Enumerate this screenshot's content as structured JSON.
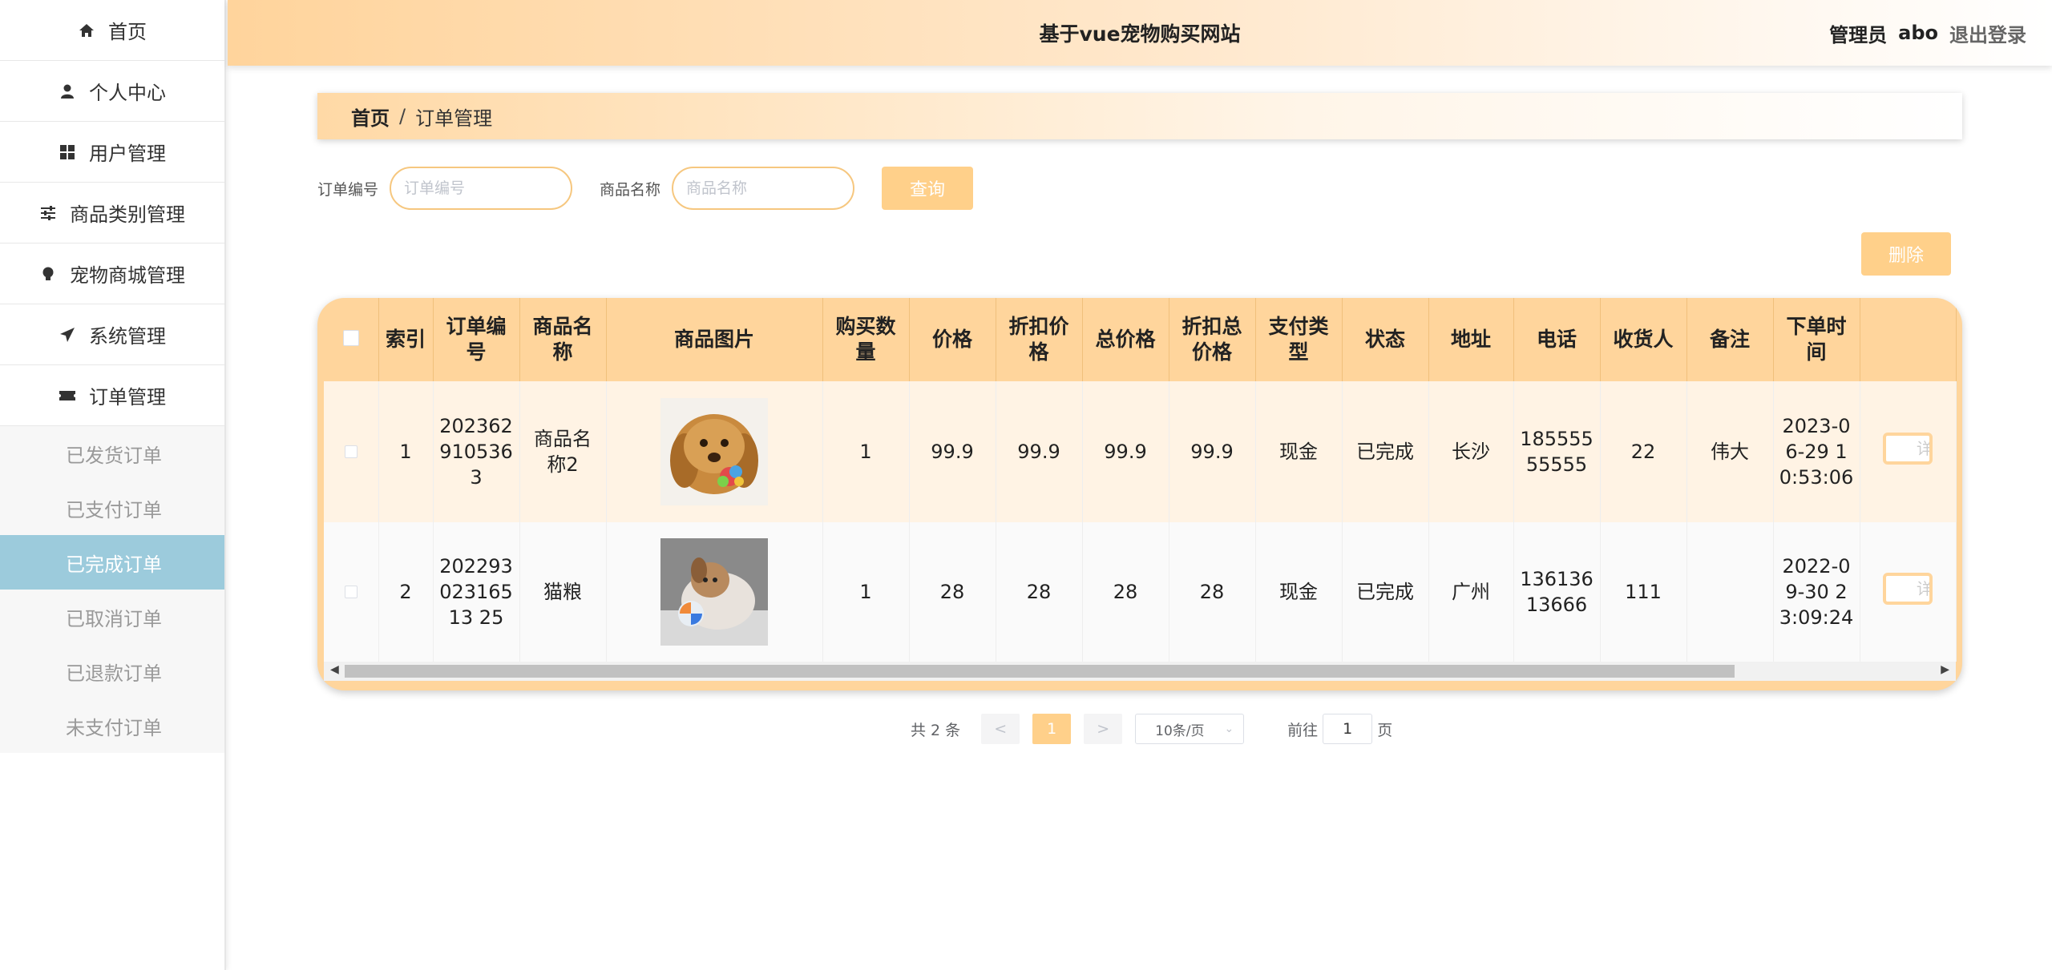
{
  "sidebar": {
    "items": [
      {
        "label": "首页",
        "icon": "home-icon"
      },
      {
        "label": "个人中心",
        "icon": "user-icon"
      },
      {
        "label": "用户管理",
        "icon": "grid-icon"
      },
      {
        "label": "商品类别管理",
        "icon": "sliders-icon"
      },
      {
        "label": "宠物商城管理",
        "icon": "bulb-icon"
      },
      {
        "label": "系统管理",
        "icon": "send-icon"
      },
      {
        "label": "订单管理",
        "icon": "ticket-icon"
      }
    ],
    "sub_items": [
      "已发货订单",
      "已支付订单",
      "已完成订单",
      "已取消订单",
      "已退款订单",
      "未支付订单"
    ],
    "active_sub": "已完成订单"
  },
  "header": {
    "title": "基于vue宠物购买网站",
    "role": "管理员",
    "username": "abo",
    "logout": "退出登录"
  },
  "breadcrumb": {
    "home": "首页",
    "sep": "/",
    "current": "订单管理"
  },
  "search": {
    "order_no_label": "订单编号",
    "order_no_placeholder": "订单编号",
    "goods_name_label": "商品名称",
    "goods_name_placeholder": "商品名称",
    "query_label": "查询"
  },
  "delete_label": "删除",
  "table": {
    "columns": [
      "索引",
      "订单编号",
      "商品名称",
      "商品图片",
      "购买数量",
      "价格",
      "折扣价格",
      "总价格",
      "折扣总价格",
      "支付类型",
      "状态",
      "地址",
      "电话",
      "收货人",
      "备注",
      "下单时间"
    ],
    "rows": [
      {
        "index": "1",
        "order_no": "202362910536 3",
        "goods_name": "商品名称2",
        "image": "dog-with-toy",
        "qty": "1",
        "price": "99.9",
        "discount_price": "99.9",
        "total": "99.9",
        "discount_total": "99.9",
        "pay_type": "现金",
        "status": "已完成",
        "address": "长沙",
        "phone": "18555555555",
        "receiver": "22",
        "remark": "伟大",
        "time": "2023-06-29 10:53:06",
        "action": "详情"
      },
      {
        "index": "2",
        "order_no": "20229302316513 25",
        "goods_name": "猫粮",
        "image": "dog-with-ball",
        "qty": "1",
        "price": "28",
        "discount_price": "28",
        "total": "28",
        "discount_total": "28",
        "pay_type": "现金",
        "status": "已完成",
        "address": "广州",
        "phone": "13613613666",
        "receiver": "111",
        "remark": "",
        "time": "2022-09-30 23:09:24",
        "action": "详情"
      }
    ]
  },
  "pager": {
    "total_text": "共 2 条",
    "prev": "<",
    "current_page": "1",
    "next": ">",
    "page_size": "10条/页",
    "goto_label": "前往",
    "goto_value": "1",
    "page_suffix": "页"
  },
  "colors": {
    "accent": "#ffd08a",
    "header_bg": "#ffd49c",
    "active_menu": "#9ccbdc"
  }
}
